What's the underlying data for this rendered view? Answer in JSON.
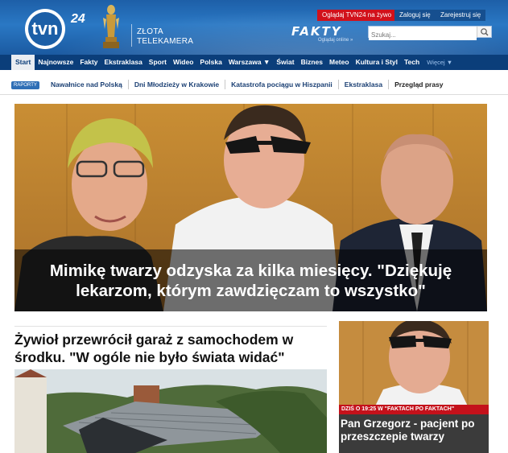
{
  "header": {
    "logo_text": "tvn24",
    "award": {
      "line1": "ZŁOTA",
      "line2": "TELEKAMERA"
    },
    "top_links": {
      "live": "Oglądaj TVN24 na żywo",
      "login": "Zaloguj się",
      "register": "Zarejestruj się"
    },
    "fakty": {
      "title": "FAKTY",
      "subtitle": "Oglądaj online »"
    },
    "search": {
      "placeholder": "Szukaj..."
    }
  },
  "nav": {
    "items": [
      {
        "label": "Start",
        "active": true
      },
      {
        "label": "Najnowsze"
      },
      {
        "label": "Fakty"
      },
      {
        "label": "Ekstraklasa"
      },
      {
        "label": "Sport"
      },
      {
        "label": "Wideo"
      },
      {
        "label": "Polska"
      },
      {
        "label": "Warszawa ▼"
      },
      {
        "label": "Świat"
      },
      {
        "label": "Biznes"
      },
      {
        "label": "Meteo"
      },
      {
        "label": "Kultura i Styl"
      },
      {
        "label": "Tech"
      }
    ],
    "more": "Więcej ▼"
  },
  "topics": {
    "badge": "RAPORTY",
    "items": [
      "Nawałnice nad Polską",
      "Dni Młodzieży w Krakowie",
      "Katastrofa pociągu w Hiszpanii",
      "Ekstraklasa",
      "Przegląd prasy"
    ]
  },
  "hero": {
    "title": "Mimikę twarzy odzyska za kilka miesięcy. \"Dziękuję lekarzom, którym zawdzięczam to wszystko\""
  },
  "story": {
    "title": "Żywioł przewrócił garaż z samochodem w środku. \"W ogóle nie było świata widać\""
  },
  "side": {
    "tag": "DZIŚ O 19:25 W \"FAKTACH PO FAKTACH\"",
    "title": "Pan Grzegorz - pacjent po przeszczepie twarzy"
  },
  "colors": {
    "header_blue": "#1d5fa8",
    "nav_dark_blue": "#0b3e7a",
    "live_red": "#d1111b",
    "tag_red": "#c4111b",
    "topic_blue": "#1a3f73"
  }
}
